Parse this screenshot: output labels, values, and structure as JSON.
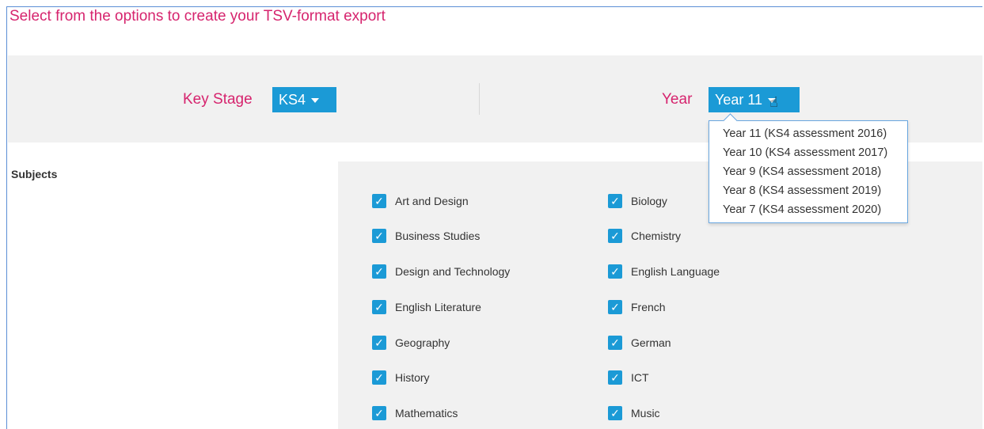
{
  "page_title": "Select from the options to create your TSV-format export",
  "filters": {
    "key_stage_label": "Key Stage",
    "key_stage_value": "KS4",
    "year_label": "Year",
    "year_value": "Year 11"
  },
  "year_options": [
    "Year 11 (KS4 assessment 2016)",
    "Year 10 (KS4 assessment 2017)",
    "Year 9 (KS4 assessment 2018)",
    "Year 8 (KS4 assessment 2019)",
    "Year 7 (KS4 assessment 2020)"
  ],
  "subjects": {
    "label": "Subjects",
    "left_column": [
      {
        "name": "Art and Design",
        "checked": true
      },
      {
        "name": "Business Studies",
        "checked": true
      },
      {
        "name": "Design and Technology",
        "checked": true
      },
      {
        "name": "English Literature",
        "checked": true
      },
      {
        "name": "Geography",
        "checked": true
      },
      {
        "name": "History",
        "checked": true
      },
      {
        "name": "Mathematics",
        "checked": true
      }
    ],
    "right_column": [
      {
        "name": "Biology",
        "checked": true
      },
      {
        "name": "Chemistry",
        "checked": true
      },
      {
        "name": "English Language",
        "checked": true
      },
      {
        "name": "French",
        "checked": true
      },
      {
        "name": "German",
        "checked": true
      },
      {
        "name": "ICT",
        "checked": true
      },
      {
        "name": "Music",
        "checked": true
      }
    ]
  },
  "colors": {
    "accent": "#d6246e",
    "button": "#1b9ad6",
    "panel": "#f1f1f1"
  },
  "icons": {
    "checkbox": "check-icon",
    "caret": "chevron-down-icon",
    "cursor": "hand-pointer-icon"
  }
}
